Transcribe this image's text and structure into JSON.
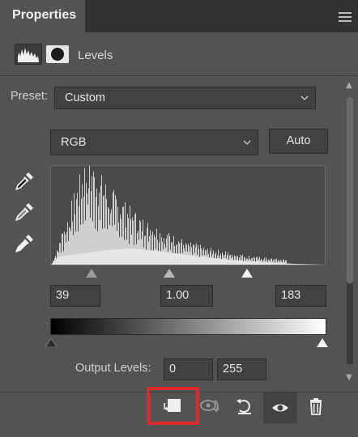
{
  "panel": {
    "tab_title": "Properties",
    "adjustment_title": "Levels"
  },
  "preset": {
    "label": "Preset:",
    "value": "Custom"
  },
  "channel": {
    "value": "RGB"
  },
  "auto_button": "Auto",
  "input_levels": {
    "shadow": "39",
    "midtone": "1.00",
    "highlight": "183"
  },
  "output_levels": {
    "label": "Output Levels:",
    "min": "0",
    "max": "255"
  },
  "icons": {
    "tab_menu": "hamburger-menu-icon",
    "adjustment": "levels-histogram-icon",
    "mask": "layer-mask-icon",
    "droppers": [
      "black-point-eyedropper-icon",
      "gray-point-eyedropper-icon",
      "white-point-eyedropper-icon"
    ],
    "toolbar": [
      "clip-to-layer-icon",
      "view-previous-state-icon",
      "reset-icon",
      "visibility-eye-icon",
      "trash-icon"
    ]
  },
  "colors": {
    "panel_bg": "#535353",
    "tab_bar": "#323232",
    "field_bg": "#424242",
    "highlight_box": "#e0292d"
  }
}
